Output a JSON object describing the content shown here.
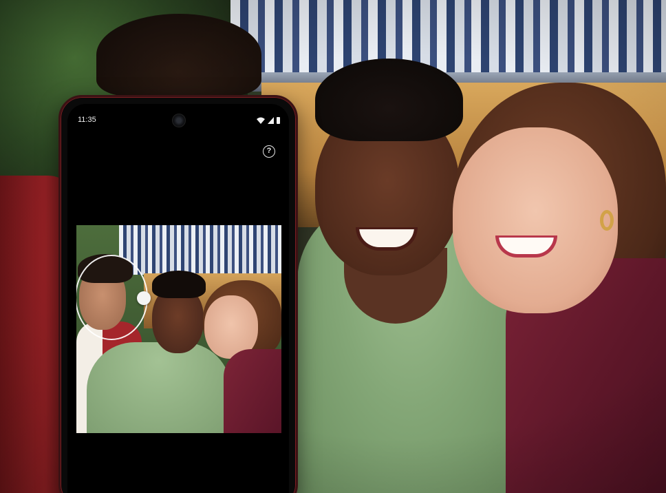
{
  "phone": {
    "status_bar": {
      "time": "11:35",
      "icons": [
        "wifi-icon",
        "signal-icon",
        "battery-icon"
      ]
    },
    "help_icon_glyph": "?",
    "preview": {
      "face_selector": "face-ring"
    }
  },
  "colors": {
    "phone_frame": "#3b1214",
    "screen": "#000000",
    "ring": "#ffffff"
  }
}
